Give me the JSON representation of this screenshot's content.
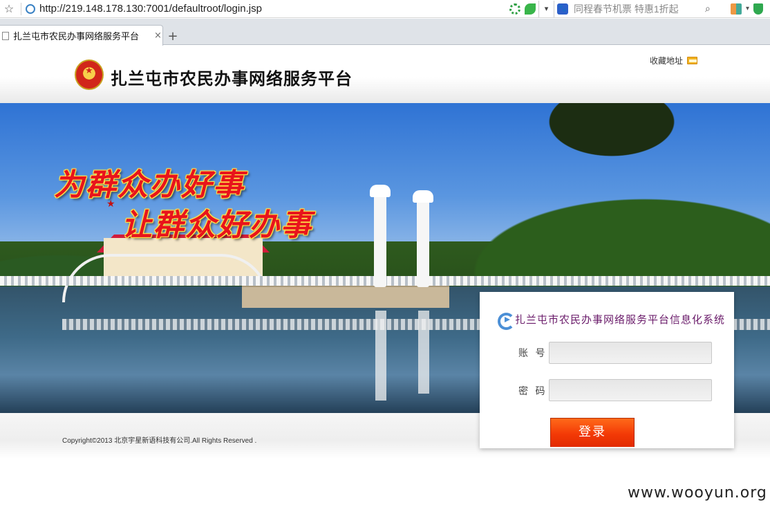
{
  "browser": {
    "url": "http://219.148.178.130:7001/defaultroot/login.jsp",
    "search_placeholder": "同程春节机票  特惠1折起",
    "tab": {
      "title": "扎兰屯市农民办事网络服务平台",
      "close": "×"
    },
    "new_tab": "+"
  },
  "header": {
    "site_title": "扎兰屯市农民办事网络服务平台",
    "favorite_label": "收藏地址"
  },
  "banner": {
    "slogan_line1": "为群众办好事",
    "slogan_line2": "让群众好办事"
  },
  "login": {
    "title": "扎兰屯市农民办事网络服务平台信息化系统",
    "username_label": "账 号",
    "username_value": "",
    "password_label": "密 码",
    "password_value": "",
    "submit_label": "登录"
  },
  "footer": {
    "copyright": "Copyright©2013 北京宇星新语科技有公司.All Rights Reserved ."
  },
  "watermark": "www.wooyun.org"
}
